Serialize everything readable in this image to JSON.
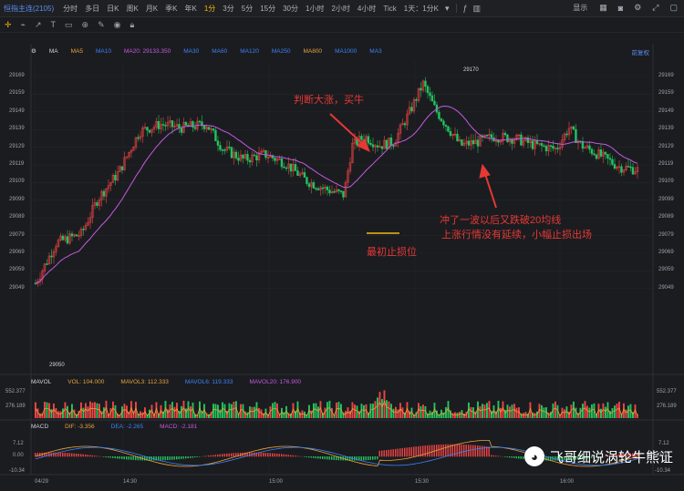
{
  "symbol": "恒指主连(2105)",
  "timeframes": [
    "分时",
    "多日",
    "日K",
    "周K",
    "月K",
    "季K",
    "年K",
    "1分",
    "3分",
    "5分",
    "15分",
    "30分",
    "1小时",
    "2小时",
    "4小时",
    "Tick",
    "1天：1分K"
  ],
  "active_timeframe": "1分",
  "top_right": [
    "显示"
  ],
  "ma_legend": {
    "head": "MA",
    "items": [
      {
        "label": "MA5",
        "color": "#e6a23c"
      },
      {
        "label": "MA10",
        "color": "#3b82f6"
      },
      {
        "label": "MA20: 29133.350",
        "color": "#c45adf"
      },
      {
        "label": "MA30",
        "color": "#3b82f6"
      },
      {
        "label": "MA60",
        "color": "#3b82f6"
      },
      {
        "label": "MA120",
        "color": "#3b82f6"
      },
      {
        "label": "MA250",
        "color": "#3b82f6"
      },
      {
        "label": "MA800",
        "color": "#e6a23c"
      },
      {
        "label": "MA1000",
        "color": "#3b82f6"
      },
      {
        "label": "MA3",
        "color": "#3b82f6"
      }
    ],
    "right": "前复权"
  },
  "price_ticks": [
    "29169",
    "29159",
    "29149",
    "29139",
    "29129",
    "29119",
    "29109",
    "29099",
    "29089",
    "29079",
    "29069",
    "29059",
    "29049"
  ],
  "high_label": "29170",
  "low_label": "29050",
  "vol_legend": {
    "head": "MAVOL",
    "items": [
      "VOL: 104.000",
      "MAVOL3: 112.333",
      "MAVOL6: 119.333",
      "MAVOL20: 176.900"
    ]
  },
  "vol_ticks": [
    "552.377",
    "276.189"
  ],
  "macd_legend": {
    "head": "MACD",
    "items": [
      "DIF: -3.356",
      "DEA: -2.265",
      "MACD: -2.181"
    ]
  },
  "macd_ticks": [
    "7.12",
    "0.00",
    "-10.34"
  ],
  "time_ticks": [
    "04/29",
    "14:30",
    "15:00",
    "15:30",
    "16:00"
  ],
  "annotations": {
    "buy": "判断大涨，买牛",
    "stop": "最初止损位",
    "exit_line1": "冲了一波以后又跌破20均线",
    "exit_line2": "上涨行情没有延续，小幅止损出场"
  },
  "watermark": "飞哥细说涡轮牛熊证",
  "colors": {
    "up": "#ef4444",
    "down": "#22c55e",
    "ma20": "#c45adf",
    "annotation": "#e53935",
    "stop_line": "#f0b90b"
  }
}
